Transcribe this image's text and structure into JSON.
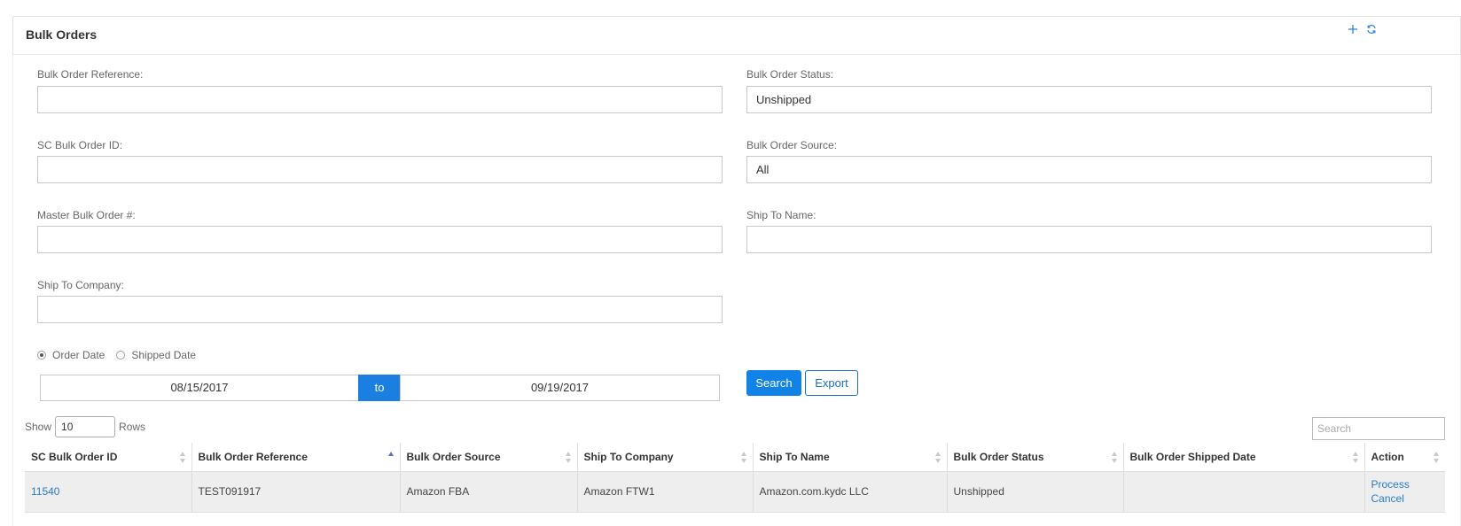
{
  "panel": {
    "title": "Bulk Orders",
    "add_icon": "plus-icon",
    "refresh_icon": "refresh-icon"
  },
  "filters": {
    "bulk_order_reference": {
      "label": "Bulk Order Reference:",
      "value": ""
    },
    "bulk_order_status": {
      "label": "Bulk Order Status:",
      "value": "Unshipped"
    },
    "sc_bulk_order_id": {
      "label": "SC Bulk Order ID:",
      "value": ""
    },
    "bulk_order_source": {
      "label": "Bulk Order Source:",
      "value": "All"
    },
    "master_bulk_order": {
      "label": "Master Bulk Order #:",
      "value": ""
    },
    "ship_to_name": {
      "label": "Ship To Name:",
      "value": ""
    },
    "ship_to_company": {
      "label": "Ship To Company:",
      "value": ""
    }
  },
  "date_filter": {
    "options": [
      {
        "label": "Order Date",
        "checked": true
      },
      {
        "label": "Shipped Date",
        "checked": false
      }
    ],
    "from": "08/15/2017",
    "separator": "to",
    "to": "09/19/2017"
  },
  "buttons": {
    "search": "Search",
    "export": "Export"
  },
  "table_controls": {
    "show_label": "Show",
    "rows_value": "10",
    "rows_label": "Rows",
    "search_placeholder": "Search"
  },
  "table": {
    "columns": [
      "SC Bulk Order ID",
      "Bulk Order Reference",
      "Bulk Order Source",
      "Ship To Company",
      "Ship To Name",
      "Bulk Order Status",
      "Bulk Order Shipped Date",
      "Action"
    ],
    "sorted_column": "Bulk Order Reference",
    "rows": [
      {
        "sc_bulk_order_id": "11540",
        "bulk_order_reference": "TEST091917",
        "bulk_order_source": "Amazon FBA",
        "ship_to_company": "Amazon FTW1",
        "ship_to_name": "Amazon.com.kydc LLC",
        "bulk_order_status": "Unshipped",
        "bulk_order_shipped_date": "",
        "actions": [
          "Process",
          "Cancel"
        ]
      }
    ]
  },
  "colors": {
    "accent": "#1283e6",
    "link": "#2a7ac2",
    "row_background": "#eeeeee"
  }
}
